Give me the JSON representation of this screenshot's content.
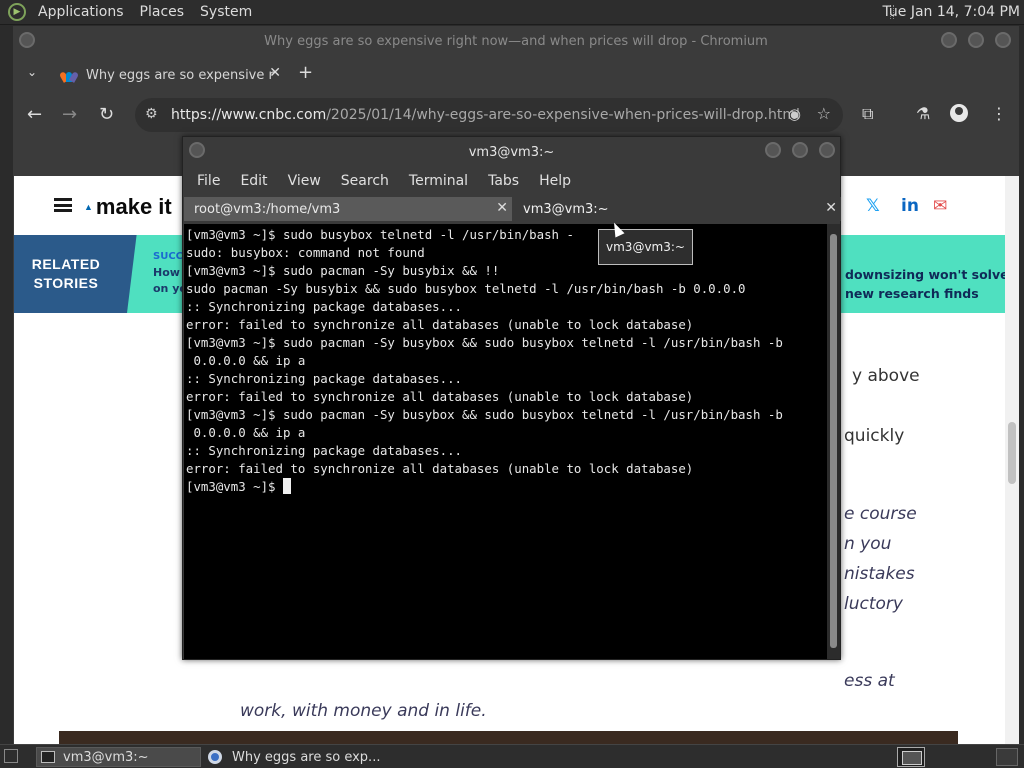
{
  "top_panel": {
    "menus": [
      "Applications",
      "Places",
      "System"
    ],
    "clock": "Tue Jan 14,  7:04 PM"
  },
  "browser": {
    "window_title": "Why eggs are so expensive right now—and when prices will drop - Chromium",
    "tab_title": "Why eggs are so expensive r",
    "url_host": "https://www.cnbc.com",
    "url_path": "/2025/01/14/why-eggs-are-so-expensive-when-prices-will-drop.html"
  },
  "page": {
    "brand": "make it",
    "related_label_line1": "RELATED",
    "related_label_line2": "STORIES",
    "related_left_line1": "SUCC",
    "related_left_line2": "How",
    "related_left_line3": "on yo",
    "related_right_line1": "downsizing won't solve i",
    "related_right_line2": "new research finds",
    "text_lines": [
      "y above",
      "quickly",
      "e course",
      "n you",
      "nistakes",
      "luctory",
      "ess at",
      "work, with money and in life."
    ]
  },
  "terminal": {
    "window_title": "vm3@vm3:~",
    "menus": [
      "File",
      "Edit",
      "View",
      "Search",
      "Terminal",
      "Tabs",
      "Help"
    ],
    "tab1": "root@vm3:/home/vm3",
    "tab2": "vm3@vm3:~",
    "tooltip": "vm3@vm3:~",
    "lines": [
      "[vm3@vm3 ~]$ sudo busybox telnetd -l /usr/bin/bash -",
      "sudo: busybox: command not found",
      "[vm3@vm3 ~]$ sudo pacman -Sy busybix && !!",
      "sudo pacman -Sy busybix && sudo busybox telnetd -l /usr/bin/bash -b 0.0.0.0",
      ":: Synchronizing package databases...",
      "error: failed to synchronize all databases (unable to lock database)",
      "[vm3@vm3 ~]$ sudo pacman -Sy busybox && sudo busybox telnetd -l /usr/bin/bash -b",
      " 0.0.0.0 && ip a",
      ":: Synchronizing package databases...",
      "error: failed to synchronize all databases (unable to lock database)",
      "[vm3@vm3 ~]$ sudo pacman -Sy busybox && sudo busybox telnetd -l /usr/bin/bash -b",
      " 0.0.0.0 && ip a",
      ":: Synchronizing package databases...",
      "error: failed to synchronize all databases (unable to lock database)",
      "[vm3@vm3 ~]$ "
    ]
  },
  "taskbar": {
    "task1": "vm3@vm3:~",
    "task2": "Why eggs are so exp..."
  }
}
